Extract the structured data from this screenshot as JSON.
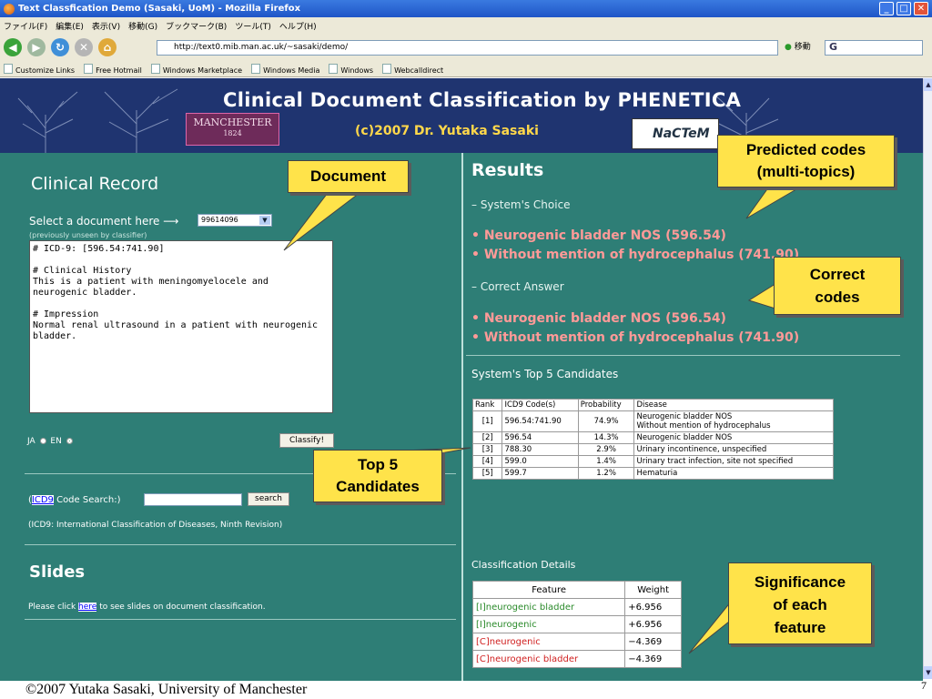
{
  "window": {
    "title": "Text Classfication Demo (Sasaki, UoM) - Mozilla Firefox",
    "menu": [
      "ファイル(F)",
      "編集(E)",
      "表示(V)",
      "移動(G)",
      "ブックマーク(B)",
      "ツール(T)",
      "ヘルプ(H)"
    ],
    "url": "http://text0.mib.man.ac.uk/~sasaki/demo/",
    "go_label": "移動",
    "search_value": "G",
    "bookmarks": [
      "Customize Links",
      "Free Hotmail",
      "Windows Marketplace",
      "Windows Media",
      "Windows",
      "Webcalldirect"
    ]
  },
  "banner": {
    "title": "Clinical Document Classification by PHENETICA",
    "manchester_logo": "MANCHESTER",
    "manchester_year": "1824",
    "copyright": "(c)2007 Dr. Yutaka Sasaki",
    "nactem_logo": "NaCTeM"
  },
  "left": {
    "title": "Clinical Record",
    "select_label": "Select a document here ⟶",
    "selected_doc": "99614096",
    "unseen_note": "(previously unseen by classifier)",
    "document_text": "# ICD-9: [596.54:741.90]\n\n# Clinical History\nThis is a patient with meningomyelocele and\nneurogenic bladder.\n\n# Impression\nNormal renal ultrasound in a patient with neurogenic\nbladder.",
    "lang_ja": "JA",
    "lang_en": "EN",
    "classify_label": "Classify!",
    "icd_open": "(",
    "icd_link": "ICD9",
    "icd_label": " Code Search:)",
    "search_button": "search",
    "icd_note": "(ICD9: International Classification of Diseases, Ninth Revision)",
    "slides_title": "Slides",
    "slides_pre": "Please click ",
    "slides_link": "here",
    "slides_post": " to see slides on document classification."
  },
  "results": {
    "title": "Results",
    "system_choice_label": "– System's Choice",
    "system_choice": [
      "• Neurogenic bladder NOS (596.54)",
      "• Without mention of hydrocephalus (741.90)"
    ],
    "correct_label": "– Correct Answer",
    "correct": [
      "• Neurogenic bladder NOS (596.54)",
      "• Without mention of hydrocephalus (741.90)"
    ],
    "top5_title": "System's Top 5 Candidates",
    "top5_headers": [
      "Rank",
      "ICD9 Code(s)",
      "Probability",
      "Disease"
    ],
    "top5_rows": [
      [
        "[1]",
        "596.54:741.90",
        "74.9%",
        "Neurogenic bladder NOS\nWithout mention of hydrocephalus"
      ],
      [
        "[2]",
        "596.54",
        "14.3%",
        "Neurogenic bladder NOS"
      ],
      [
        "[3]",
        "788.30",
        "2.9%",
        "Urinary incontinence, unspecified"
      ],
      [
        "[4]",
        "599.0",
        "1.4%",
        "Urinary tract infection, site not specified"
      ],
      [
        "[5]",
        "599.7",
        "1.2%",
        "Hematuria"
      ]
    ],
    "details_title": "Classification Details",
    "feature_headers": [
      "Feature",
      "Weight"
    ],
    "feature_rows": [
      [
        "[I]neurogenic bladder",
        "+6.956"
      ],
      [
        "[I]neurogenic",
        "+6.956"
      ],
      [
        "[C]neurogenic",
        "−4.369"
      ],
      [
        "[C]neurogenic bladder",
        "−4.369"
      ]
    ]
  },
  "callouts": {
    "document": "Document",
    "predicted": "Predicted codes\n(multi-topics)",
    "correct": "Correct\ncodes",
    "top5": "Top 5\nCandidates",
    "significance": "Significance\nof each\nfeature"
  },
  "footer": {
    "text": "©2007 Yutaka Sasaki, University of Manchester",
    "page_number": "7"
  },
  "colors": {
    "titlebar": "#2a62d4",
    "page_bg": "#2e7e76",
    "banner_bg": "#1f3470",
    "prediction": "#ff9a98",
    "callout": "#ffe34a",
    "link": "#0000ff"
  }
}
